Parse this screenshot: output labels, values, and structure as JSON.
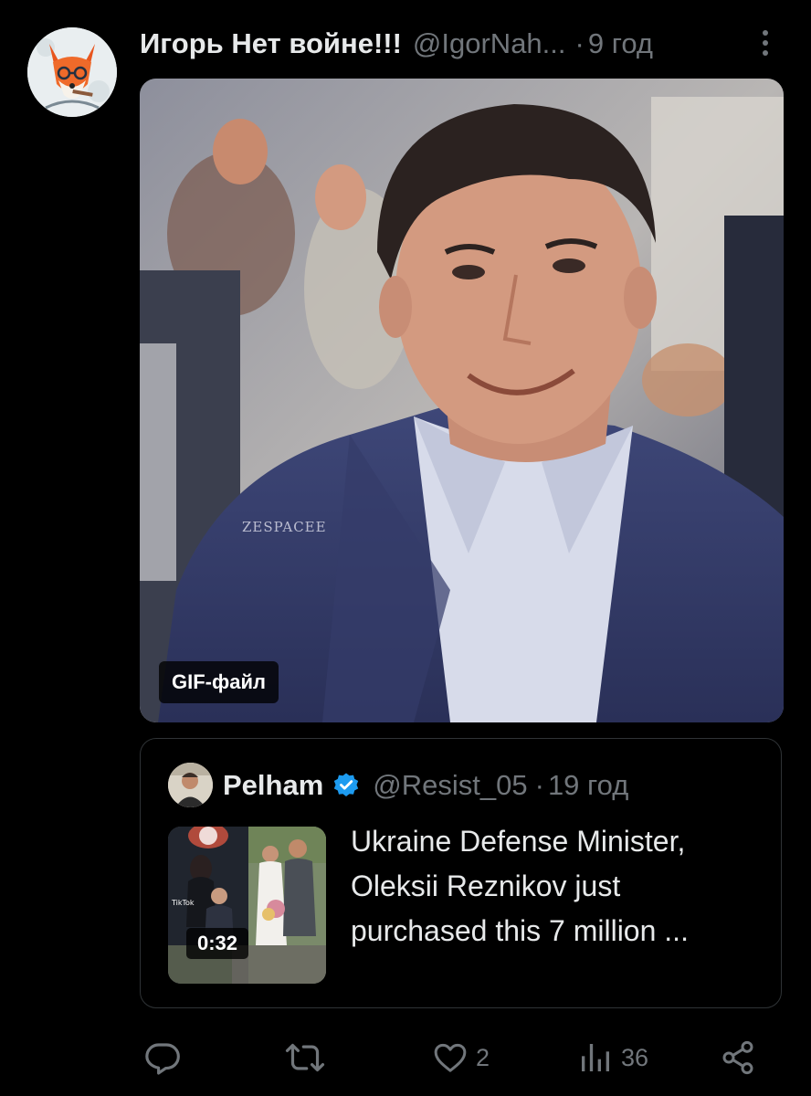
{
  "tweet": {
    "author_name": "Игорь Нет войне!!!",
    "author_handle": "@IgorNah...",
    "separator": "·",
    "time": "9 год",
    "media": {
      "badge": "GIF-файл",
      "watermark": "ZESPACEE"
    }
  },
  "quote": {
    "author_name": "Pelham",
    "author_handle": "@Resist_05",
    "separator": "·",
    "time": "19 год",
    "text_lines": [
      "Ukraine Defense Minister,",
      "Oleksii Reznikov just",
      "purchased this 7 million ..."
    ],
    "thumbnail": {
      "duration": "0:32",
      "tiktok_label": "TikTok"
    }
  },
  "actions": {
    "reply": {
      "icon": "reply-icon",
      "count": ""
    },
    "retweet": {
      "icon": "retweet-icon",
      "count": ""
    },
    "like": {
      "icon": "heart-icon",
      "count": "2"
    },
    "views": {
      "icon": "analytics-icon",
      "count": "36"
    },
    "share": {
      "icon": "share-icon"
    }
  },
  "colors": {
    "background": "#000000",
    "text_primary": "#e7e9ea",
    "text_secondary": "#71767b",
    "border": "#2f3336",
    "verified": "#1d9bf0"
  }
}
